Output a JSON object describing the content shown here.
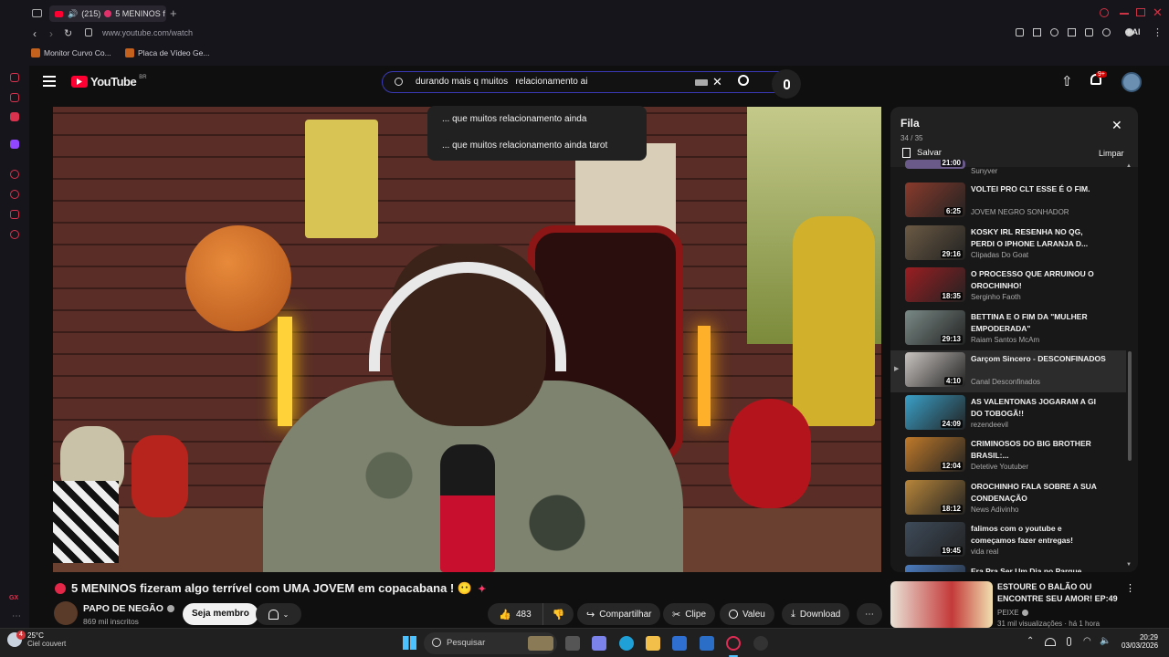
{
  "browser": {
    "tab_count": "(215)",
    "tab_title": "5 MENINOS f",
    "url": "www.youtube.com/watch",
    "bookmarks": [
      "Monitor Curvo Co...",
      "Placa de Vídeo Ge..."
    ],
    "ai_label": "AI",
    "tab_count_badge_color": "#e0316a"
  },
  "youtube": {
    "logo": "YouTube",
    "region": "BR",
    "notif_badge": "9+",
    "search": {
      "query": "durando mais q muitos   relacionamento ai",
      "suggestions": [
        "... que muitos relacionamento ainda",
        "... que muitos relacionamento ainda tarot"
      ]
    },
    "video": {
      "title": "5 MENINOS fizeram algo terrível com UMA JOVEM em copacabana ! 😶",
      "channel": "PAPO DE NEGÃO",
      "subscribers": "869 mil inscritos",
      "join_label": "Seja membro",
      "likes": "483",
      "share_label": "Compartilhar",
      "clip_label": "Clipe",
      "thanks_label": "Valeu",
      "download_label": "Download"
    },
    "queue": {
      "title": "Fila",
      "position": "34 / 35",
      "save_label": "Salvar",
      "clear_label": "Limpar",
      "partial_top": {
        "duration": "21:00",
        "channel": "Sunyver"
      },
      "items": [
        {
          "title": "VOLTEI PRO CLT ESSE É O FIM.",
          "channel": "JOVEM NEGRO SONHADOR",
          "duration": "6:25",
          "thumb": "#8a3b2c"
        },
        {
          "title": "KOSKY IRL RESENHA NO QG, PERDI O IPHONE LARANJA D...",
          "channel": "Clipadas Do Goat",
          "duration": "29:16",
          "thumb": "#6b5a44"
        },
        {
          "title": "O PROCESSO QUE ARRUINOU O OROCHINHO!",
          "channel": "Serginho Faoth",
          "duration": "18:35",
          "thumb": "#9b1e22"
        },
        {
          "title": "BETTINA E O FIM DA \"MULHER EMPODERADA\"",
          "channel": "Raiam Santos McAm",
          "duration": "29:13",
          "thumb": "#7a8a86"
        },
        {
          "title": "Garçom Sincero - DESCONFINADOS",
          "channel": "Canal Desconfinados",
          "duration": "4:10",
          "thumb": "#c9c4c0",
          "current": true
        },
        {
          "title": "AS VALENTONAS JOGARAM A GI DO TOBOGÃ!!",
          "channel": "rezendeevil",
          "duration": "24:09",
          "thumb": "#3aa0c8"
        },
        {
          "title": "CRIMINOSOS DO BIG BROTHER BRASIL:...",
          "channel": "Detetive Youtuber",
          "duration": "12:04",
          "thumb": "#c07a2a"
        },
        {
          "title": "OROCHINHO FALA SOBRE A SUA CONDENAÇÃO",
          "channel": "News Adivinho",
          "duration": "18:12",
          "thumb": "#b8863a"
        },
        {
          "title": "falimos com o youtube e começamos fazer entregas!",
          "channel": "vida real",
          "duration": "19:45",
          "thumb": "#3e4b5a"
        },
        {
          "title": "Era Pra Ser Um Dia no Parque",
          "channel": "",
          "duration": "",
          "thumb": "#4b7cc0"
        }
      ]
    },
    "recommended": {
      "title": "ESTOURE O BALÃO OU ENCONTRE SEU AMOR! EP:49",
      "channel": "PEIXE",
      "meta": "31 mil visualizações · há 1 hora"
    }
  },
  "taskbar": {
    "weather_temp": "25°C",
    "weather_desc": "Ciel couvert",
    "weather_badge": "4",
    "search_placeholder": "Pesquisar",
    "time": "20:29",
    "date": "03/03/2026"
  },
  "colors": {
    "accent_red": "#ff0033",
    "opera_red": "#d8324e",
    "yt_bg": "#0f0f0f"
  }
}
